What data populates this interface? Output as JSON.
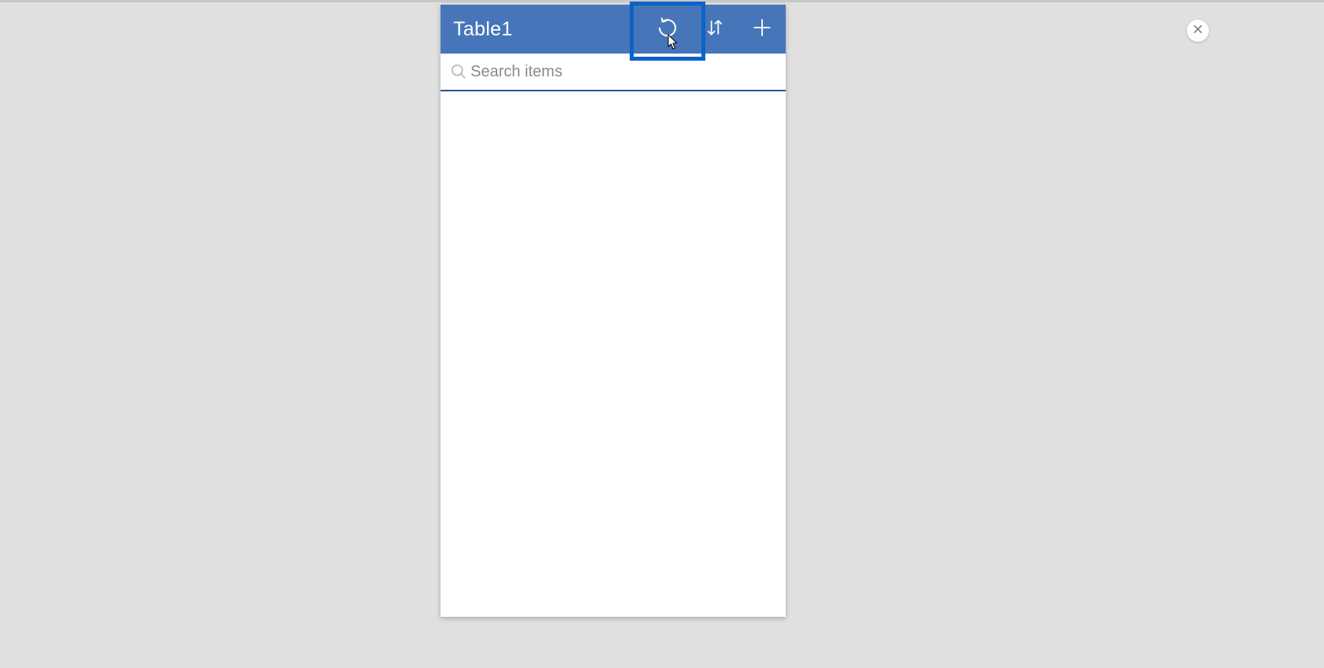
{
  "panel": {
    "title": "Table1",
    "actions": {
      "refresh": "refresh",
      "sort": "sort",
      "add": "add"
    }
  },
  "search": {
    "placeholder": "Search items",
    "value": ""
  },
  "close": {
    "label": "close"
  },
  "colors": {
    "header_bg": "#4775b9",
    "highlight_border": "#0a64ca",
    "search_underline": "#2a5293"
  }
}
